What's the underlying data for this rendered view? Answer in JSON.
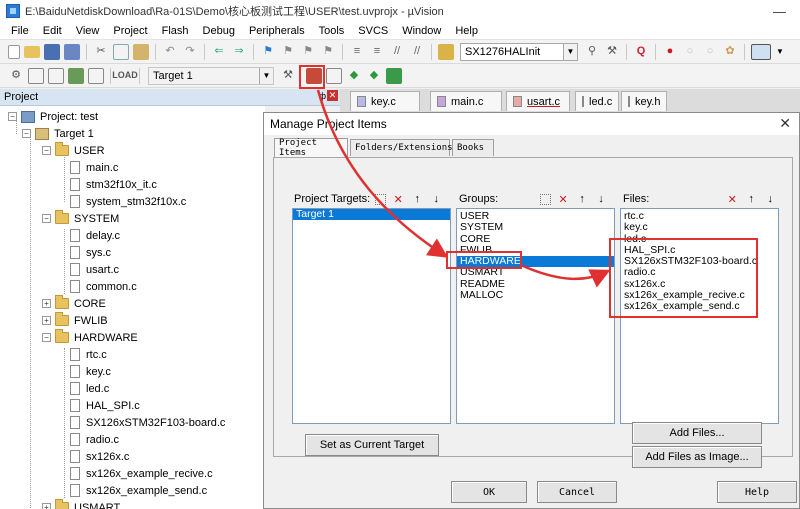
{
  "window": {
    "title": "E:\\BaiduNetdiskDownload\\Ra-01S\\Demo\\核心板测试工程\\USER\\test.uvprojx - µVision"
  },
  "menu": [
    "File",
    "Edit",
    "View",
    "Project",
    "Flash",
    "Debug",
    "Peripherals",
    "Tools",
    "SVCS",
    "Window",
    "Help"
  ],
  "toolbar": {
    "find_combo": "SX1276HALInit",
    "target_combo": "Target 1"
  },
  "project_panel": {
    "title": "Project",
    "pin": "ф",
    "tree": [
      {
        "label": "Project: test",
        "level": 0,
        "kind": "project",
        "expander": "−"
      },
      {
        "label": "Target 1",
        "level": 1,
        "kind": "target",
        "expander": "−"
      },
      {
        "label": "USER",
        "level": 2,
        "kind": "folder",
        "expander": "−"
      },
      {
        "label": "main.c",
        "level": 3,
        "kind": "file"
      },
      {
        "label": "stm32f10x_it.c",
        "level": 3,
        "kind": "file"
      },
      {
        "label": "system_stm32f10x.c",
        "level": 3,
        "kind": "file"
      },
      {
        "label": "SYSTEM",
        "level": 2,
        "kind": "folder",
        "expander": "−"
      },
      {
        "label": "delay.c",
        "level": 3,
        "kind": "file"
      },
      {
        "label": "sys.c",
        "level": 3,
        "kind": "file"
      },
      {
        "label": "usart.c",
        "level": 3,
        "kind": "file"
      },
      {
        "label": "common.c",
        "level": 3,
        "kind": "file"
      },
      {
        "label": "CORE",
        "level": 2,
        "kind": "folder",
        "expander": "+"
      },
      {
        "label": "FWLIB",
        "level": 2,
        "kind": "folder",
        "expander": "+"
      },
      {
        "label": "HARDWARE",
        "level": 2,
        "kind": "folder",
        "expander": "−"
      },
      {
        "label": "rtc.c",
        "level": 3,
        "kind": "file"
      },
      {
        "label": "key.c",
        "level": 3,
        "kind": "file"
      },
      {
        "label": "led.c",
        "level": 3,
        "kind": "file"
      },
      {
        "label": "HAL_SPI.c",
        "level": 3,
        "kind": "file"
      },
      {
        "label": "SX126xSTM32F103-board.c",
        "level": 3,
        "kind": "file"
      },
      {
        "label": "radio.c",
        "level": 3,
        "kind": "file"
      },
      {
        "label": "sx126x.c",
        "level": 3,
        "kind": "file"
      },
      {
        "label": "sx126x_example_recive.c",
        "level": 3,
        "kind": "file"
      },
      {
        "label": "sx126x_example_send.c",
        "level": 3,
        "kind": "file"
      },
      {
        "label": "USMART",
        "level": 2,
        "kind": "folder",
        "expander": "+"
      }
    ]
  },
  "editor_tabs": [
    {
      "label": "key.c",
      "color": "#b9b9e8"
    },
    {
      "label": "main.c",
      "color": "#c8a6dc"
    },
    {
      "label": "usart.c",
      "color": "#e8a9a9"
    },
    {
      "label": "led.c",
      "color": "#b5d9b5"
    },
    {
      "label": "key.h",
      "color": "#f0e0a0"
    }
  ],
  "dialog": {
    "title": "Manage Project Items",
    "close": "✕",
    "tabs": [
      "Project Items",
      "Folders/Extensions",
      "Books"
    ],
    "targets_label": "Project Targets:",
    "groups_label": "Groups:",
    "files_label": "Files:",
    "targets": [
      "Target 1"
    ],
    "groups": [
      "USER",
      "SYSTEM",
      "CORE",
      "FWLIB",
      "HARDWARE",
      "USMART",
      "README",
      "MALLOC"
    ],
    "selected_group": "HARDWARE",
    "files": [
      "rtc.c",
      "key.c",
      "led.c",
      "HAL_SPI.c",
      "SX126xSTM32F103-board.c",
      "radio.c",
      "sx126x.c",
      "sx126x_example_recive.c",
      "sx126x_example_send.c"
    ],
    "set_current_target": "Set as Current Target",
    "add_files": "Add Files...",
    "add_files_image": "Add Files as Image...",
    "ok": "OK",
    "cancel": "Cancel",
    "help": "Help"
  },
  "colors": {
    "highlight": "#e03030",
    "selection": "#0a7ad6"
  }
}
